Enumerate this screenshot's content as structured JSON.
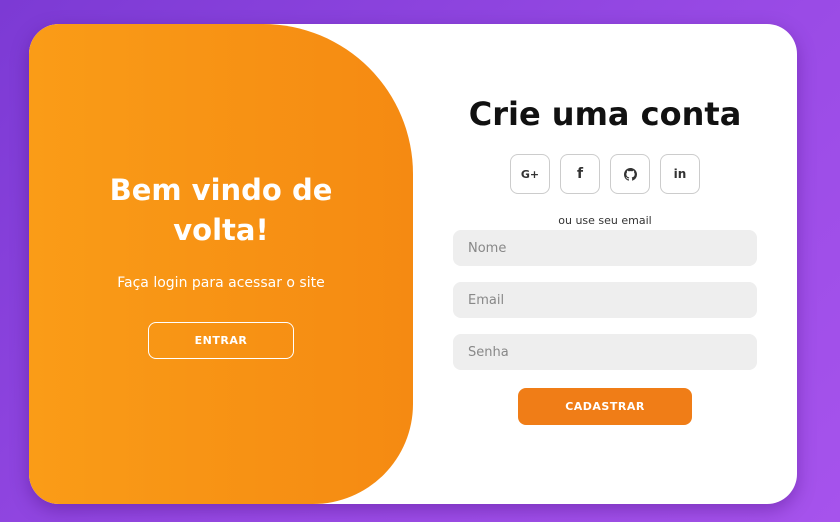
{
  "colors": {
    "background_gradient": [
      "#7c3ad4",
      "#a653ec"
    ],
    "accent": "#f07d17",
    "panel_gradient": [
      "#fa9c17",
      "#f58a12"
    ],
    "input_background": "#eeeeee"
  },
  "welcome": {
    "title": "Bem vindo de volta!",
    "subtitle": "Faça login para acessar o site",
    "login_button": "ENTRAR"
  },
  "signup": {
    "title": "Crie uma conta",
    "social": [
      {
        "icon": "google-plus-icon",
        "label": "G+"
      },
      {
        "icon": "facebook-icon",
        "label": "f"
      },
      {
        "icon": "github-icon"
      },
      {
        "icon": "linkedin-icon",
        "label": "in"
      }
    ],
    "divider": "ou use seu email",
    "fields": {
      "name_placeholder": "Nome",
      "email_placeholder": "Email",
      "password_placeholder": "Senha"
    },
    "submit_button": "CADASTRAR"
  }
}
